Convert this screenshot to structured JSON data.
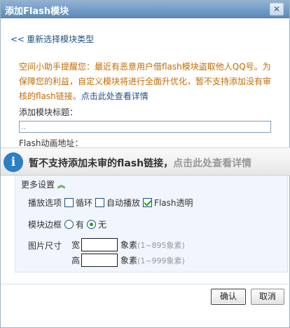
{
  "dialog": {
    "title": "添加Flash模块",
    "close_glyph": "✕"
  },
  "back_link": {
    "chevron": "<<",
    "label": "重新选择模块类型"
  },
  "notice": {
    "text": "空间小助手提醒您：最近有恶意用户借flash模块盗取他人QQ号。为保障您的利益，自定义模块将进行全面升优化，暂不支持添加没有审核的flash链接。",
    "link": "点击此处查看详情"
  },
  "form": {
    "title_label": "添加模块标题：",
    "title_value": "..",
    "address_label": "Flash动画地址："
  },
  "banner": {
    "icon": "i",
    "message": "暂不支持添加未审的flash链接，",
    "link": "点击此处查看详情"
  },
  "more_settings": {
    "label": "更多设置",
    "arrow": "︽",
    "play_options": {
      "label": "播放选项",
      "loop": {
        "label": "循环",
        "checked": false
      },
      "autoplay": {
        "label": "自动播放",
        "checked": false
      },
      "transparent": {
        "label": "Flash透明",
        "checked": true
      }
    },
    "border": {
      "label": "模块边框",
      "yes": {
        "label": "有",
        "checked": false
      },
      "no": {
        "label": "无",
        "checked": true
      }
    },
    "size": {
      "label": "图片尺寸",
      "width_label": "宽",
      "height_label": "高",
      "unit": "象素",
      "width_hint": "(1~895象素)",
      "height_hint": "(1~999象素)",
      "width_value": "",
      "height_value": ""
    }
  },
  "buttons": {
    "ok": "确认",
    "cancel": "取消"
  }
}
